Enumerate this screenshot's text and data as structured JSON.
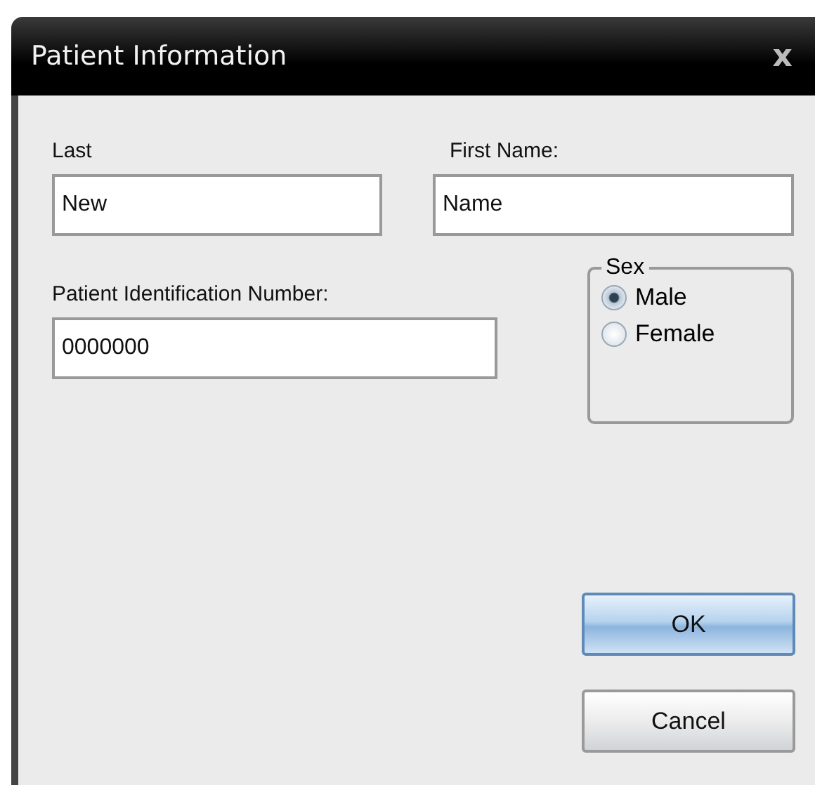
{
  "window": {
    "title": "Patient Information",
    "close": "x"
  },
  "last": {
    "label": "Last",
    "value": "New"
  },
  "first": {
    "label": "First Name:",
    "value": "Name"
  },
  "id": {
    "label": "Patient Identification Number:",
    "value": "0000000"
  },
  "sex": {
    "label": "Sex",
    "options": [
      {
        "label": "Male",
        "selected": true
      },
      {
        "label": "Female",
        "selected": false
      }
    ]
  },
  "buttons": [
    {
      "label": "OK",
      "default": true
    },
    {
      "label": "Cancel",
      "default": false
    }
  ]
}
